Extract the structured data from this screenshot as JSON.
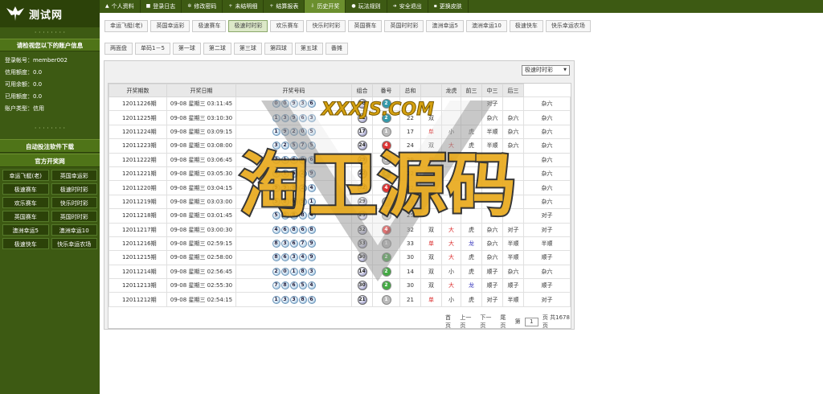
{
  "logo": {
    "text": "测试网"
  },
  "sidebar": {
    "dots_top": "· · · · · · · ·",
    "account_title": "请检视您以下的账户信息",
    "account": [
      {
        "label": "登录帐号：",
        "value": "member002"
      },
      {
        "label": "信用额度：",
        "value": "0.0"
      },
      {
        "label": "可用余额：",
        "value": "0.0"
      },
      {
        "label": "已用额度：",
        "value": "0.0"
      },
      {
        "label": "账户类型：",
        "value": "信用"
      }
    ],
    "dots_bottom": "· · · · · · · ·",
    "auto_bet": "自动投注软件下载",
    "official": "官方开奖网",
    "games": [
      "幸运飞艇(老)",
      "英国幸运彩",
      "极速赛车",
      "极速时时彩",
      "欢乐赛车",
      "快乐时时彩",
      "英国赛车",
      "英国时时彩",
      "澳洲幸运5",
      "澳洲幸运10",
      "极速快车",
      "快乐幸运农场"
    ]
  },
  "topnav": [
    {
      "icon": "user-icon",
      "glyph": "▲",
      "label": "个人资料",
      "active": false
    },
    {
      "icon": "log-icon",
      "glyph": "■",
      "label": "登录日志",
      "active": false
    },
    {
      "icon": "gear-icon",
      "glyph": "✲",
      "label": "修改密码",
      "active": false
    },
    {
      "icon": "plus-icon",
      "glyph": "+",
      "label": "未结明细",
      "active": false
    },
    {
      "icon": "plus-icon",
      "glyph": "+",
      "label": "结算报表",
      "active": false
    },
    {
      "icon": "history-icon",
      "glyph": "⇩",
      "label": "历史开奖",
      "active": true
    },
    {
      "icon": "info-icon",
      "glyph": "●",
      "label": "玩法规则",
      "active": false
    },
    {
      "icon": "logout-icon",
      "glyph": "➜",
      "label": "安全退出",
      "active": false
    },
    {
      "icon": "skin-icon",
      "glyph": "▪",
      "label": "更换皮肤",
      "active": false
    }
  ],
  "game_tabs": [
    {
      "label": "幸运飞艇(老)",
      "active": false
    },
    {
      "label": "英国幸运彩",
      "active": false
    },
    {
      "label": "极速赛车",
      "active": false
    },
    {
      "label": "极速时时彩",
      "active": true
    },
    {
      "label": "欢乐赛车",
      "active": false
    },
    {
      "label": "快乐时时彩",
      "active": false
    },
    {
      "label": "英国赛车",
      "active": false
    },
    {
      "label": "英国时时彩",
      "active": false
    },
    {
      "label": "澳洲幸运5",
      "active": false
    },
    {
      "label": "澳洲幸运10",
      "active": false
    },
    {
      "label": "极速快车",
      "active": false
    },
    {
      "label": "快乐幸运农场",
      "active": false
    }
  ],
  "bet_tabs": [
    "两面盘",
    "单码1－5",
    "第一球",
    "第二球",
    "第三球",
    "第四球",
    "第五球",
    "番摊"
  ],
  "select": {
    "value": "极速时时彩"
  },
  "table": {
    "headers": [
      "开奖期数",
      "开奖日期",
      "开奖号码",
      "组合",
      "番号",
      "总和",
      "",
      "龙虎",
      "前三",
      "中三",
      "后三"
    ],
    "rows": [
      {
        "period": "12011226期",
        "date": "09-08 星期三 03:11:45",
        "balls": [
          "0",
          "0",
          "9",
          "3",
          "6"
        ],
        "combo": "18",
        "code": "2",
        "code_color": "#39a",
        "sum": "",
        "ds": "",
        "dx": "",
        "lh": "",
        "q3": "对子",
        "z3": "",
        "h3": "杂六"
      },
      {
        "period": "12011225期",
        "date": "09-08 星期三 03:10:30",
        "balls": [
          "1",
          "3",
          "9",
          "6",
          "3"
        ],
        "combo": "22",
        "code": "2",
        "code_color": "#39a",
        "sum": "22",
        "ds": "双",
        "dx": "",
        "lh": "",
        "q3": "杂六",
        "z3": "杂六",
        "h3": "杂六"
      },
      {
        "period": "12011224期",
        "date": "09-08 星期三 03:09:15",
        "balls": [
          "1",
          "9",
          "2",
          "0",
          "5"
        ],
        "combo": "17",
        "code": "1",
        "code_color": "#bbb",
        "sum": "17",
        "ds": "单",
        "dx": "小",
        "lh": "虎",
        "q3": "半顺",
        "z3": "杂六",
        "h3": "杂六"
      },
      {
        "period": "12011223期",
        "date": "09-08 星期三 03:08:00",
        "balls": [
          "3",
          "2",
          "5",
          "7",
          "5"
        ],
        "combo": "24",
        "code": "4",
        "code_color": "#d33",
        "sum": "24",
        "ds": "双",
        "dx": "大",
        "lh": "虎",
        "q3": "半顺",
        "z3": "杂六",
        "h3": "杂六"
      },
      {
        "period": "12011222期",
        "date": "09-08 星期三 03:06:45",
        "balls": [
          "7",
          "1",
          "6",
          "9",
          "6"
        ],
        "combo": "29",
        "code": "1",
        "code_color": "#bbb",
        "sum": "29",
        "ds": "单",
        "dx": "大",
        "lh": "",
        "q3": "",
        "z3": "",
        "h3": "杂六"
      },
      {
        "period": "12011221期",
        "date": "09-08 星期三 03:05:30",
        "balls": [
          "4",
          "1",
          "6",
          "2",
          "9"
        ],
        "combo": "22",
        "code": "2",
        "code_color": "#39a",
        "sum": "22",
        "ds": "",
        "dx": "",
        "lh": "",
        "q3": "",
        "z3": "",
        "h3": "杂六"
      },
      {
        "period": "12011220期",
        "date": "09-08 星期三 03:04:15",
        "balls": [
          "9",
          "9",
          "8",
          "2",
          "4"
        ],
        "combo": "32",
        "code": "4",
        "code_color": "#d33",
        "sum": "32",
        "ds": "",
        "dx": "",
        "lh": "",
        "q3": "",
        "z3": "",
        "h3": "杂六"
      },
      {
        "period": "12011219期",
        "date": "09-08 星期三 03:03:00",
        "balls": [
          "5",
          "8",
          "6",
          "9",
          "1"
        ],
        "combo": "29",
        "code": "1",
        "code_color": "#bbb",
        "sum": "29",
        "ds": "",
        "dx": "",
        "lh": "",
        "q3": "",
        "z3": "",
        "h3": "杂六"
      },
      {
        "period": "12011218期",
        "date": "09-08 星期三 03:01:45",
        "balls": [
          "5",
          "0",
          "8",
          "8",
          "4"
        ],
        "combo": "25",
        "code": "1",
        "code_color": "#bbb",
        "sum": "25",
        "ds": "",
        "dx": "",
        "lh": "",
        "q3": "",
        "z3": "",
        "h3": "对子"
      },
      {
        "period": "12011217期",
        "date": "09-08 星期三 03:00:30",
        "balls": [
          "4",
          "6",
          "8",
          "6",
          "8"
        ],
        "combo": "32",
        "code": "4",
        "code_color": "#d33",
        "sum": "32",
        "ds": "双",
        "dx": "大",
        "lh": "虎",
        "q3": "杂六",
        "z3": "对子",
        "h3": "对子"
      },
      {
        "period": "12011216期",
        "date": "09-08 星期三 02:59:15",
        "balls": [
          "8",
          "3",
          "6",
          "7",
          "9"
        ],
        "combo": "33",
        "code": "1",
        "code_color": "#bbb",
        "sum": "33",
        "ds": "单",
        "dx": "大",
        "lh": "龙",
        "q3": "杂六",
        "z3": "半顺",
        "h3": "半顺"
      },
      {
        "period": "12011215期",
        "date": "09-08 星期三 02:58:00",
        "balls": [
          "8",
          "6",
          "3",
          "4",
          "9"
        ],
        "combo": "30",
        "code": "2",
        "code_color": "#4a4",
        "sum": "30",
        "ds": "双",
        "dx": "大",
        "lh": "虎",
        "q3": "杂六",
        "z3": "半顺",
        "h3": "顺子"
      },
      {
        "period": "12011214期",
        "date": "09-08 星期三 02:56:45",
        "balls": [
          "2",
          "0",
          "1",
          "8",
          "3"
        ],
        "combo": "14",
        "code": "2",
        "code_color": "#4a4",
        "sum": "14",
        "ds": "双",
        "dx": "小",
        "lh": "虎",
        "q3": "顺子",
        "z3": "杂六",
        "h3": "杂六"
      },
      {
        "period": "12011213期",
        "date": "09-08 星期三 02:55:30",
        "balls": [
          "7",
          "8",
          "6",
          "5",
          "4"
        ],
        "combo": "30",
        "code": "2",
        "code_color": "#4a4",
        "sum": "30",
        "ds": "双",
        "dx": "大",
        "lh": "龙",
        "q3": "顺子",
        "z3": "顺子",
        "h3": "顺子"
      },
      {
        "period": "12011212期",
        "date": "09-08 星期三 02:54:15",
        "balls": [
          "1",
          "3",
          "3",
          "8",
          "6"
        ],
        "combo": "21",
        "code": "1",
        "code_color": "#bbb",
        "sum": "21",
        "ds": "单",
        "dx": "小",
        "lh": "虎",
        "q3": "对子",
        "z3": "半顺",
        "h3": "对子"
      }
    ]
  },
  "pager": {
    "first": "首页",
    "prev": "上一页",
    "next": "下一页",
    "last": "尾页",
    "page_prefix": "第",
    "page_value": "1",
    "page_suffix": "页 共1678页"
  },
  "watermark": {
    "top_text": "XXXJS.COM",
    "main_text": "淘卫源码"
  }
}
